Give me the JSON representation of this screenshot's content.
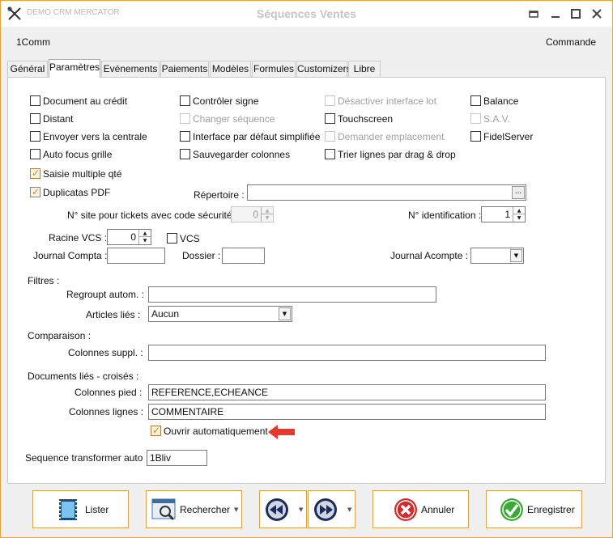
{
  "window": {
    "app_name": "DEMO CRM MERCATOR",
    "title": "Séquences Ventes"
  },
  "header": {
    "left": "1Comm",
    "right": "Commande"
  },
  "tabs": [
    "Général",
    "Paramètres",
    "Evénements",
    "Paiements",
    "Modèles",
    "Formules",
    "Customizers",
    "Libre"
  ],
  "active_tab": "Paramètres",
  "checkboxes": {
    "col1": [
      "Document au crédit",
      "Distant",
      "Envoyer vers la centrale",
      "Auto focus grille"
    ],
    "col2": [
      "Contrôler signe",
      "Changer séquence",
      "Interface par défaut simplifiée",
      "Sauvegarder colonnes"
    ],
    "col3": [
      "Désactiver interface lot",
      "Touchscreen",
      "Demander emplacement",
      "Trier lignes par drag & drop"
    ],
    "col4": [
      "Balance",
      "S.A.V.",
      "FidelServer"
    ],
    "saisie_multiple": "Saisie multiple qté",
    "duplicatas_pdf": "Duplicatas PDF",
    "vcs": "VCS",
    "ouvrir_auto": "Ouvrir automatiquement"
  },
  "fields": {
    "repertoire_label": "Répertoire :",
    "browse_label": "...",
    "site_label": "N° site pour tickets avec code sécurité :",
    "site_value": "0",
    "ident_label": "N° identification :",
    "ident_value": "1",
    "racine_label": "Racine VCS :",
    "racine_value": "0",
    "journal_compta_label": "Journal Compta :",
    "dossier_label": "Dossier :",
    "journal_acompte_label": "Journal Acompte :"
  },
  "filtres": {
    "heading": "Filtres :",
    "regroup_label": "Regroupt autom. :",
    "articles_label": "Articles liés :",
    "articles_value": "Aucun"
  },
  "comparaison": {
    "heading": "Comparaison :",
    "colonnes_suppl_label": "Colonnes suppl. :"
  },
  "documents": {
    "heading": "Documents liés - croisés :",
    "pied_label": "Colonnes pied :",
    "pied_value": "REFERENCE,ECHEANCE",
    "lignes_label": "Colonnes lignes :",
    "lignes_value": "COMMENTAIRE"
  },
  "sequence": {
    "label": "Sequence transformer auto :",
    "value": "1Bliv"
  },
  "buttons": {
    "lister": "Lister",
    "rechercher": "Rechercher",
    "annuler": "Annuler",
    "enregistrer": "Enregistrer"
  },
  "colors": {
    "accent": "#e8a33d",
    "arrow": "#e23b2e",
    "annuler_red": "#d42a2a",
    "enregistrer_green": "#3aa935",
    "nav_blue": "#1d2b5a"
  }
}
